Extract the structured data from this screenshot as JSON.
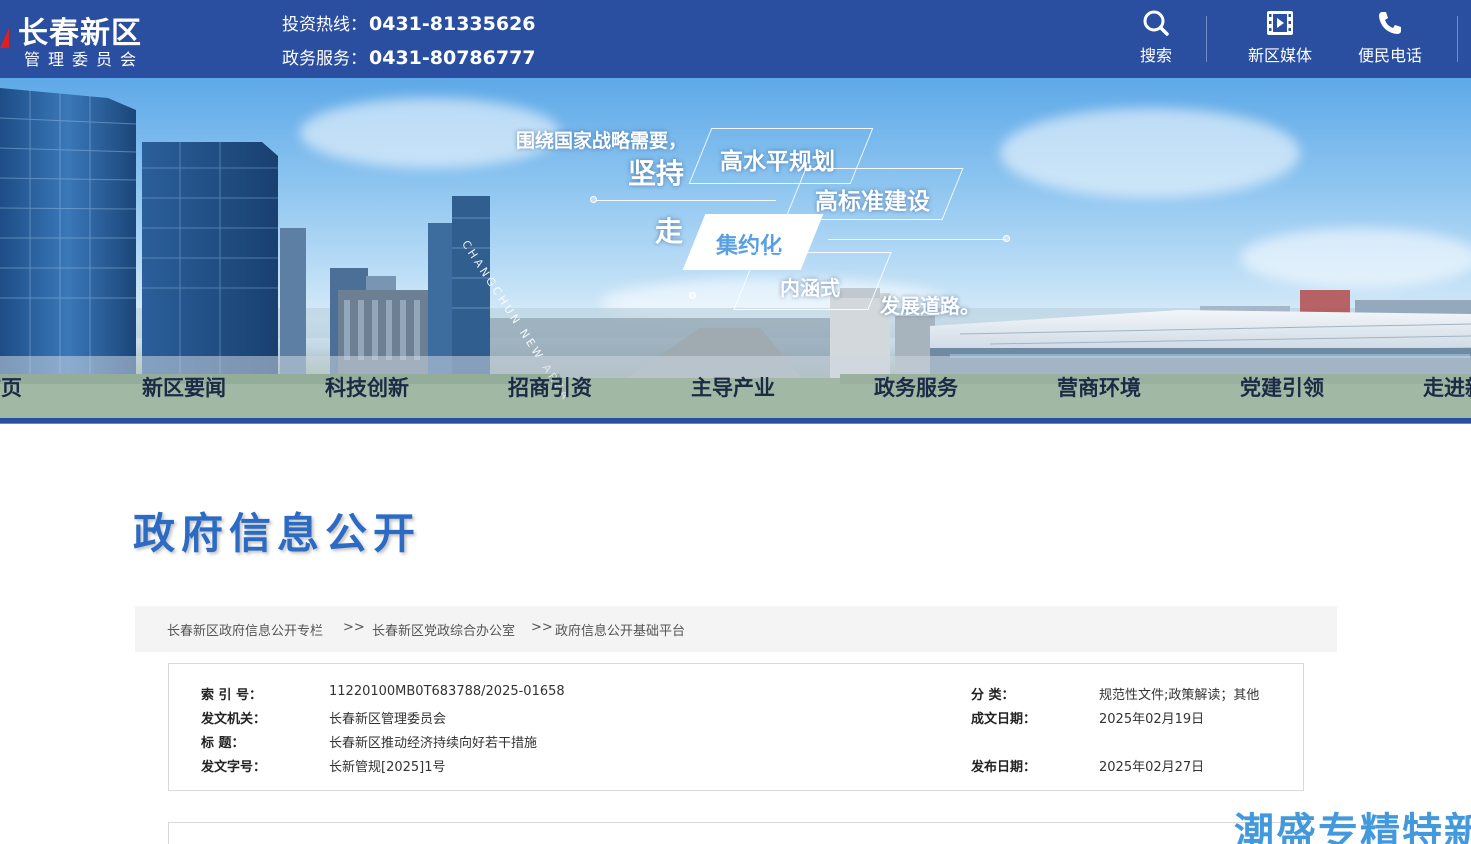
{
  "header": {
    "logo_title": "长春新区",
    "logo_subtitle": "管理委员会",
    "hotlines": [
      {
        "label": "投资热线：",
        "number": "0431-81335626"
      },
      {
        "label": "政务服务：",
        "number": "0431-80786777"
      }
    ],
    "tools": [
      {
        "label": "搜索",
        "icon": "search-icon"
      },
      {
        "label": "新区媒体",
        "icon": "film-icon"
      },
      {
        "label": "便民电话",
        "icon": "phone-icon"
      }
    ]
  },
  "banner": {
    "line1": "围绕国家战略需要，",
    "word_jianchi": "坚持",
    "box1": "高水平规划",
    "line2": "高标准建设",
    "word_zou": "走",
    "box2": "集约化",
    "line3": "内涵式",
    "line4": "发展道路。",
    "vertical_en": "CHANGCHUN NEW AREA"
  },
  "nav": {
    "items": [
      "首页",
      "新区要闻",
      "科技创新",
      "招商引资",
      "主导产业",
      "政务服务",
      "营商环境",
      "党建引领",
      "走进新区"
    ]
  },
  "content": {
    "section_title": "政府信息公开",
    "breadcrumb": [
      "长春新区政府信息公开专栏",
      "长春新区党政综合办公室",
      "政府信息公开基础平台"
    ],
    "breadcrumb_sep": ">>",
    "meta": {
      "index_label": "索 引 号：",
      "index_value": "11220100MB0T683788/2025-01658",
      "category_label": "分    类：",
      "category_value": "规范性文件;政策解读；其他",
      "issuer_label": "发文机关：",
      "issuer_value": "长春新区管理委员会",
      "created_label": "成文日期：",
      "created_value": "2025年02月19日",
      "title_label": "标      题：",
      "title_value": "长春新区推动经济持续向好若干措施",
      "docno_label": "发文字号：",
      "docno_value": "长新管规[2025]1号",
      "published_label": "发布日期：",
      "published_value": "2025年02月27日"
    }
  },
  "watermark": "潮盛专精特新",
  "colors": {
    "header_blue": "#2a4ea0",
    "title_blue": "#2b6bc4",
    "logo_red": "#e02020",
    "watermark_blue": "#2f8fd8"
  }
}
